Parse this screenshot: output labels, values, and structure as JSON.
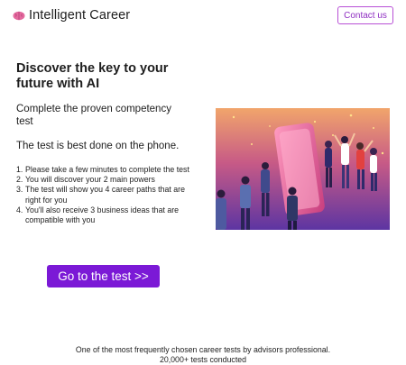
{
  "header": {
    "brand": "Intelligent Career",
    "logo_icon": "brain-icon",
    "contact_label": "Contact us"
  },
  "hero": {
    "title_prefix": "Discover the key to your future with",
    "title_bold": "AI",
    "subtitle": "Complete the proven competency test",
    "phone_note": "The test is best done on the phone.",
    "steps": [
      {
        "num": "1.",
        "text": "Please take a few minutes to complete the test"
      },
      {
        "num": "2.",
        "text": "You will discover your 2 main powers"
      },
      {
        "num": "3.",
        "text": "The test will show you 4 career paths that are right for you"
      },
      {
        "num": "4.",
        "text": "You'll also receive 3 business ideas that are compatible with you"
      }
    ],
    "cta_label": "Go to the test >>",
    "illustration": "people-celebrating-around-phone-illustration"
  },
  "footer": {
    "line1": "One of the most frequently chosen career tests by advisors professional.",
    "line2": "20,000+ tests conducted"
  },
  "colors": {
    "accent": "#7b19d6",
    "contact_border": "#b84fd6",
    "illustration_top": "#f2a26a",
    "illustration_bottom": "#6c3aa8"
  }
}
